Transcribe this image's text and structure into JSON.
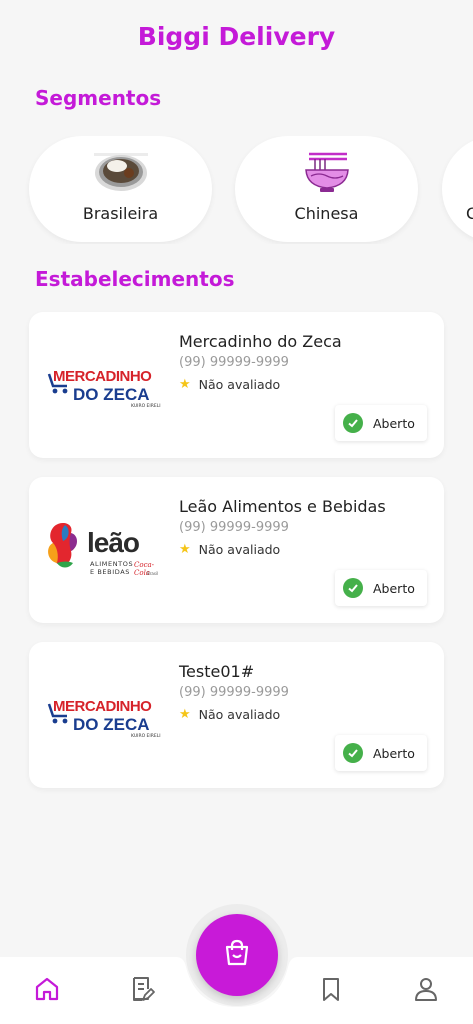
{
  "header": {
    "title": "Biggi Delivery"
  },
  "segments": {
    "title": "Segmentos",
    "items": [
      {
        "label": "Brasileira",
        "icon": "rice-plate-icon"
      },
      {
        "label": "Chinesa",
        "icon": "noodle-bowl-icon"
      },
      {
        "label": "C",
        "icon": ""
      }
    ]
  },
  "establishments": {
    "title": "Estabelecimentos",
    "items": [
      {
        "name": "Mercadinho do Zeca",
        "phone": "(99) 99999-9999",
        "rating": "Não avaliado",
        "status": "Aberto",
        "logo": {
          "line1": "MERCADINHO",
          "line2": "DO ZECA",
          "small": "KUIRO EIRELI"
        }
      },
      {
        "name": "Leão Alimentos e Bebidas",
        "phone": "(99) 99999-9999",
        "rating": "Não avaliado",
        "status": "Aberto",
        "logo": {
          "word": "leão",
          "sub1": "ALIMENTOS",
          "sub2": "E BEBIDAS",
          "brand": "Coca-Cola",
          "small": "Brasil"
        }
      },
      {
        "name": "Teste01#",
        "phone": "(99) 99999-9999",
        "rating": "Não avaliado",
        "status": "Aberto",
        "logo": {
          "line1": "MERCADINHO",
          "line2": "DO ZECA",
          "small": "KUIRO EIRELI"
        }
      }
    ]
  },
  "colors": {
    "accent": "#c41ad8",
    "open": "#45b04a",
    "star": "#f5c518"
  },
  "nav": {
    "items": [
      "home-icon",
      "orders-icon",
      "cart-icon",
      "bookmark-icon",
      "profile-icon"
    ],
    "active": "home-icon"
  }
}
